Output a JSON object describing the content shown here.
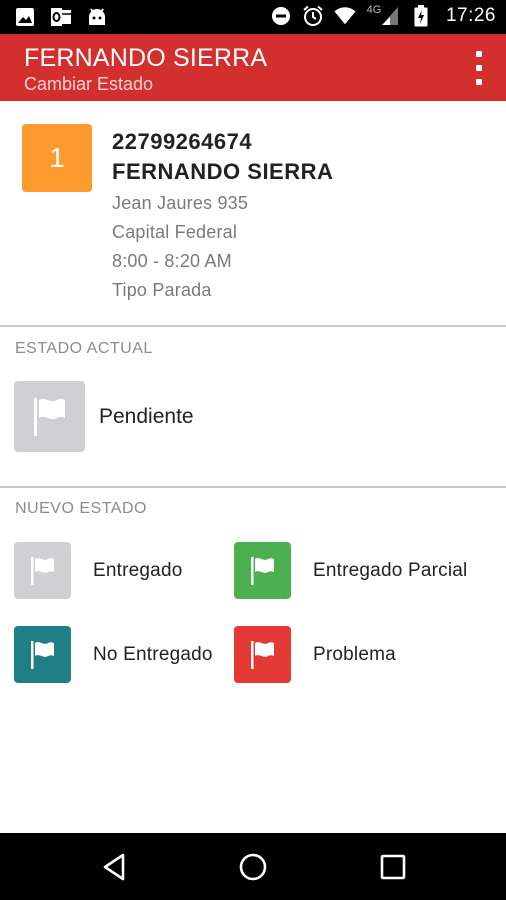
{
  "status_bar": {
    "time": "17:26",
    "network": "4G",
    "icons": [
      "image-icon",
      "outlook-icon",
      "android-icon",
      "do-not-disturb-icon",
      "alarm-icon",
      "wifi-icon",
      "signal-icon",
      "battery-icon"
    ]
  },
  "app_bar": {
    "title": "FERNANDO SIERRA",
    "subtitle": "Cambiar Estado",
    "menu_icon": "more-vert-icon"
  },
  "stop": {
    "number": "1",
    "badge_color": "#ff9a2e",
    "id": "22799264674",
    "name": "FERNANDO SIERRA",
    "address": "Jean Jaures 935",
    "city": "Capital Federal",
    "time_window": "8:00 - 8:20 AM",
    "stop_type": "Tipo Parada"
  },
  "current_state": {
    "label": "ESTADO ACTUAL",
    "value": "Pendiente",
    "icon": "flag-icon",
    "color": "#cfd0d2"
  },
  "new_state": {
    "label": "NUEVO ESTADO",
    "options": [
      {
        "label": "Entregado",
        "color": "#cfd0d2",
        "icon": "flag-icon"
      },
      {
        "label": "Entregado Parcial",
        "color": "#4caf50",
        "icon": "flag-icon"
      },
      {
        "label": "No Entregado",
        "color": "#1f7f85",
        "icon": "flag-icon"
      },
      {
        "label": "Problema",
        "color": "#e53935",
        "icon": "flag-icon"
      }
    ]
  },
  "colors": {
    "app_bar": "#d32f2f",
    "status_bar": "#000000",
    "nav_bar": "#000000"
  },
  "nav_bar": {
    "icons": [
      "back-icon",
      "home-icon",
      "recents-icon"
    ]
  }
}
